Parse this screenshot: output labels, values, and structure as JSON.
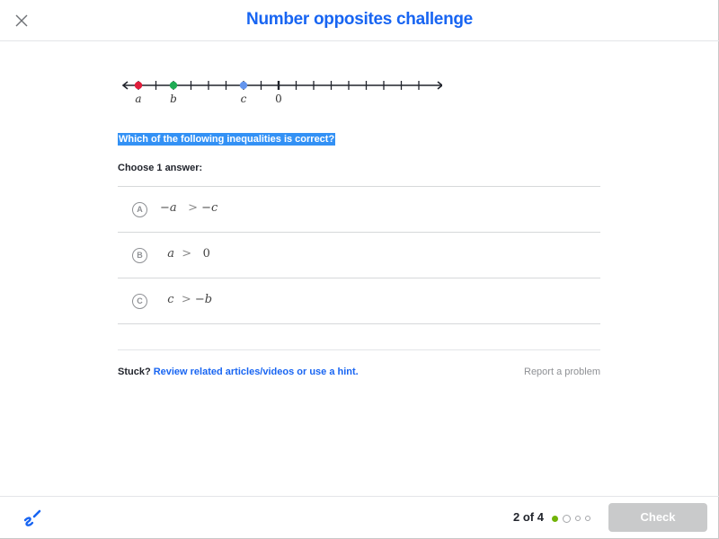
{
  "header": {
    "title": "Number opposites challenge",
    "close_icon": "close-icon"
  },
  "number_line": {
    "min": -8,
    "max": 8,
    "tick_step": 1,
    "labeled_tick": {
      "value": 0,
      "label": "0"
    },
    "points": [
      {
        "name": "a",
        "value": -8,
        "color": "#e01e3c"
      },
      {
        "name": "b",
        "value": -6,
        "color": "#1fab54"
      },
      {
        "name": "c",
        "value": -2,
        "color": "#6495ed"
      }
    ]
  },
  "question": {
    "text": "Which of the following inequalities is correct?",
    "instruction": "Choose 1 answer:"
  },
  "choices": [
    {
      "letter": "A",
      "left": "−a",
      "op": ">",
      "right": "−c"
    },
    {
      "letter": "B",
      "left": "a",
      "op": ">",
      "right": "0"
    },
    {
      "letter": "C",
      "left": "c",
      "op": ">",
      "right": "−b"
    }
  ],
  "help": {
    "stuck_label": "Stuck?",
    "link_text": "Review related articles/videos or use a hint.",
    "report_label": "Report a problem"
  },
  "footer": {
    "scratchpad_icon": "scratchpad-icon",
    "progress_text": "2 of 4",
    "progress": {
      "current": 2,
      "total": 4,
      "completed": 1
    },
    "check_label": "Check",
    "check_enabled": false,
    "colors": {
      "done": "#71b307",
      "pending": "#a4a6a9"
    }
  }
}
